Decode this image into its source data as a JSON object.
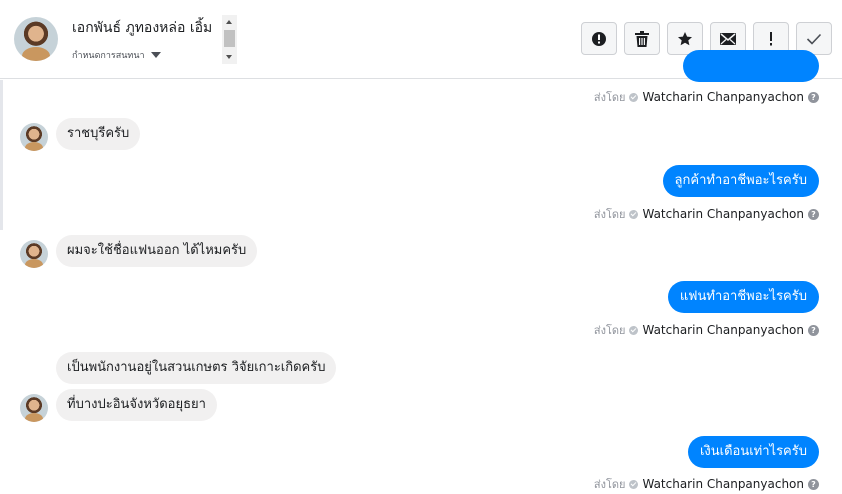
{
  "header": {
    "contact_name": "เอกพันธ์ ภูทองหล่อ เอิ้ม",
    "subline": "กำหนดการสนทนา",
    "toolbar": {
      "spam_icon": "alert-circle-icon",
      "delete_icon": "trash-icon",
      "star_icon": "star-icon",
      "unread_icon": "envelope-icon",
      "important_icon": "exclamation-icon",
      "done_icon": "check-icon"
    }
  },
  "sent_by": {
    "prefix": "ส่งโดย",
    "agent": "Watcharin Chanpanyachon",
    "help": "?"
  },
  "messages": [
    {
      "dir": "in",
      "text": "ราชบุรีครับ"
    },
    {
      "dir": "out",
      "text": "ลูกค้าทำอาชีพอะไรครับ"
    },
    {
      "dir": "in",
      "text": "ผมจะใช้ชื่อแฟนออก ได้ไหมครับ"
    },
    {
      "dir": "out",
      "text": "แฟนทำอาชีพอะไรครับ"
    },
    {
      "dir": "in",
      "text": "เป็นพนักงานอยู่ในสวนเกษตร วิจัยเกาะเกิดครับ"
    },
    {
      "dir": "in",
      "text": "ที่บางปะอินจังหวัดอยุธยา"
    },
    {
      "dir": "out",
      "text": "เงินเดือนเท่าไรครับ"
    }
  ],
  "colors": {
    "outgoing_bubble": "#0084ff",
    "incoming_bubble": "#f1f0f0"
  }
}
